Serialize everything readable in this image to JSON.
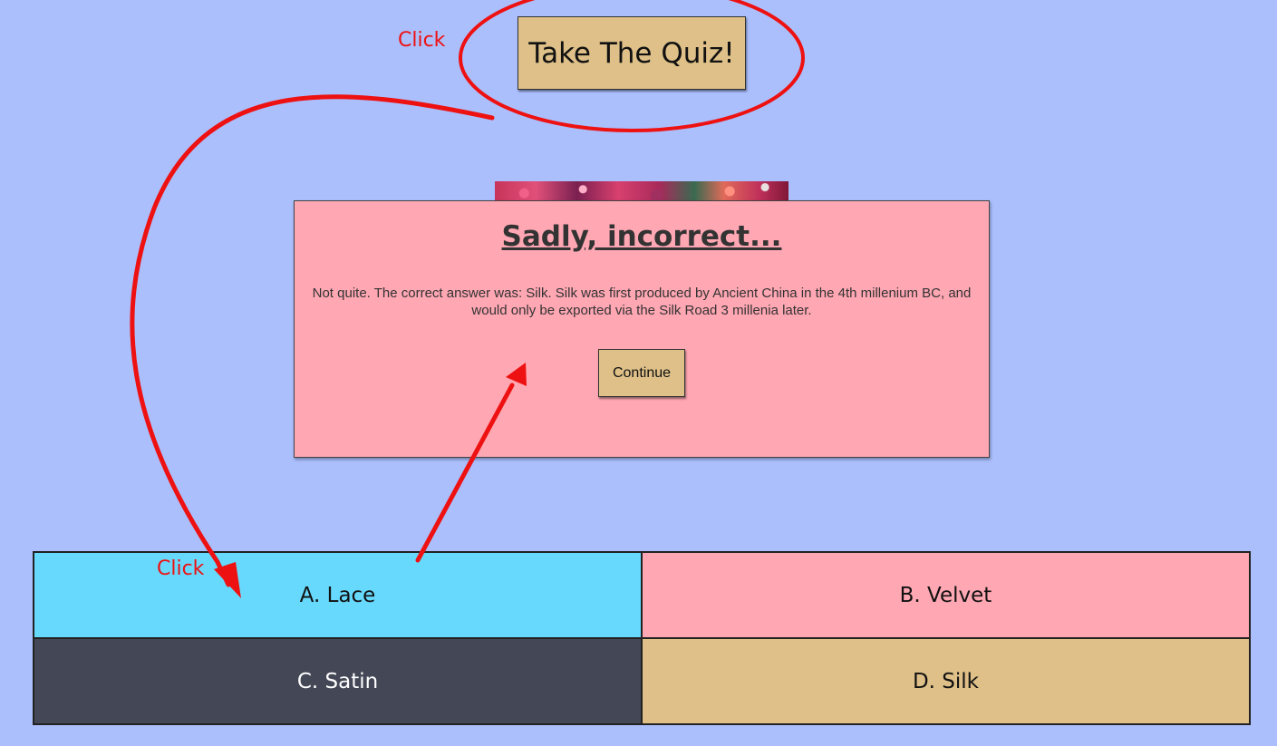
{
  "start_button": {
    "label": "Take The Quiz!"
  },
  "feedback": {
    "title": "Sadly, incorrect...",
    "message": "Not quite. The correct answer was: Silk. Silk was first produced by Ancient China in the 4th millenium BC, and would only be exported via the Silk Road 3 millenia later.",
    "continue_label": "Continue"
  },
  "answers": [
    {
      "label": "A. Lace",
      "color": "#67d9fd"
    },
    {
      "label": "B. Velvet",
      "color": "#ffa7b3"
    },
    {
      "label": "C. Satin",
      "color": "#434756"
    },
    {
      "label": "D. Silk",
      "color": "#dec088"
    }
  ],
  "annotations": {
    "click_top": "Click",
    "click_bottom": "Click",
    "color": "#ee1111"
  },
  "colors": {
    "background": "#abbffd",
    "button": "#dec088",
    "modal": "#ffa7b3"
  }
}
